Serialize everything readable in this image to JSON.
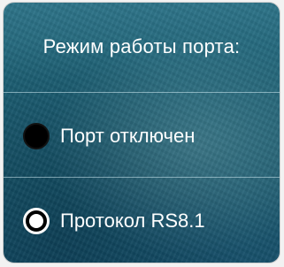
{
  "panel": {
    "title": "Режим работы порта:"
  },
  "options": [
    {
      "label": "Порт отключен",
      "selected": false
    },
    {
      "label": "Протокол RS8.1",
      "selected": true
    }
  ],
  "colors": {
    "panel_background": "#1f6276",
    "text": "#ffffff",
    "divider": "#d2ebf2",
    "radio_fill": "#000000",
    "radio_selected_dot": "#ffffff"
  }
}
